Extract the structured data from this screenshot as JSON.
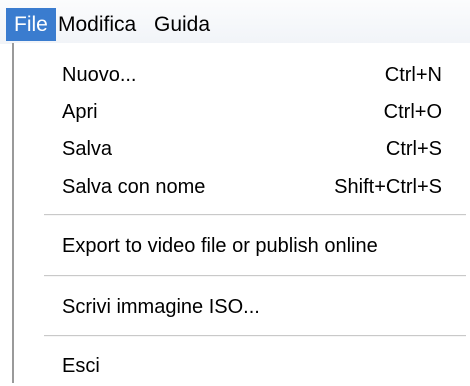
{
  "menubar": {
    "items": [
      {
        "label": "File",
        "active": true
      },
      {
        "label": "Modifica"
      },
      {
        "label": "Guida"
      }
    ]
  },
  "file_menu": {
    "items": [
      {
        "label": "Nuovo...",
        "shortcut": "Ctrl+N"
      },
      {
        "label": "Apri",
        "shortcut": "Ctrl+O"
      },
      {
        "label": "Salva",
        "shortcut": "Ctrl+S"
      },
      {
        "label": "Salva con nome",
        "shortcut": "Shift+Ctrl+S"
      },
      {
        "label": "Export to video file or publish online"
      },
      {
        "label": "Scrivi immagine ISO..."
      },
      {
        "label": "Esci"
      }
    ]
  },
  "colors": {
    "menubar_active_bg": "#3a7ccf",
    "menubar_active_text": "#ffffff"
  }
}
